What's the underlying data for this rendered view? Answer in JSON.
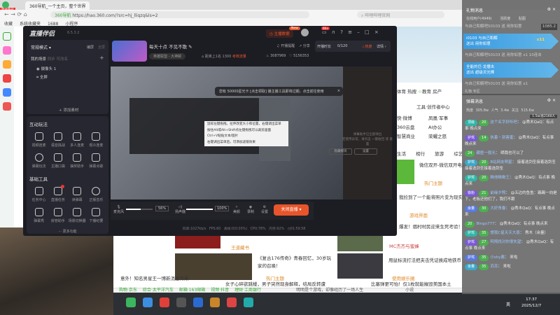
{
  "browser": {
    "tab_title": "360导航_一个主页，整个世界",
    "url": "https://hao.360.com/?src=hj_lliqzq&ls=2",
    "url_label": "360导航",
    "search_placeholder": "哔哩哔哩官网",
    "bookmarks": [
      "收藏",
      "系统收藏夹",
      "1688",
      "小程序"
    ],
    "login_badge": "登录账号"
  },
  "page": {
    "nav": [
      "体育",
      "热搜",
      "教育",
      "房产"
    ],
    "tools": "工具·创作者中心",
    "links": [
      "凤凰·军事",
      "AI办公",
      "荣耀之怒",
      "快·微博",
      "360云盘",
      "智慧商业"
    ],
    "tabs": [
      "生活",
      "榜行",
      "旅游",
      "综艺"
    ],
    "articles": [
      "微信双开-微信双开电脑版",
      "我捡到了一个能将照片变为现实的相机",
      "爆发！烟村村民迎来生死考验！",
      "《复古176传奇》青春回忆，30岁玩家的召唤！",
      "用鼠标流打法把夹击凭证换成地铁币",
      "女子心碎欲跳楼，男子突然现身解释，结局反转遭",
      "比塞弹更可怕！仅1枚就能摧毁美国本土",
      "意外！知名男星王一博新消息传来"
    ],
    "sources": [
      "热门主题",
      "游戏界面",
      "MC杰杰与蜜蜂",
      "王道藏书",
      "热门主题",
      "使用娱乐圈"
    ],
    "status": [
      "购物·京东",
      "综合·太平洋汽车",
      "邮箱·163邮箱",
      "视频·抖音",
      "理财·工商银行"
    ],
    "status_right": "明明是个游戏，却像经历了一场人生",
    "status_novel": "小说"
  },
  "app": {
    "name": "直播伴侣",
    "version": "6.5.3.2",
    "live_data": "主播数据",
    "new": "New",
    "msg_count": "99+",
    "mode": "常规模式",
    "edit": "编屏",
    "full": "全屏",
    "scene_title": "我的场景",
    "scene_actions": [
      "同步",
      "可改名"
    ],
    "sources": [
      "摄像头 1",
      "全屏"
    ],
    "add_source": "添加素材",
    "interact_title": "互动玩法",
    "interact": [
      "视频连麦",
      "语音挑战",
      "多人连麦",
      "观众连麦",
      "弹幕玩法",
      "主播口袋",
      "抽奖助手",
      "弹幕点歌"
    ],
    "tools_title": "基础工具",
    "tools": [
      "任务中心",
      "直播任务",
      "读弹幕",
      "正版音乐",
      "弹幕秀",
      "房管助手",
      "场景切换器",
      "下播纪要"
    ],
    "more": "更多功能",
    "stream_title": "每天十点 不见不散",
    "category": "英雄联盟 - 大神邮",
    "rank": "距离上1名 1300",
    "popularity": "考核流量",
    "hot": "3087969",
    "likes": "5156353",
    "remind": "开播提醒",
    "share": "分享",
    "duration_label": "开播时长",
    "duration": "0/120",
    "hotness": "热度",
    "details": "详情",
    "notice": "您有 50000星光卡 [点击领取] 播主播工具即将过期，点击前往使用",
    "tooltip": [
      "鼠标左键拖拽，拉伸改变大小和位置，右键调出菜单",
      "按住Alt或Alt+Shift点左键拖拽可以裁剪画面",
      "Ctrl+V粘贴文本/图片",
      "右键调出菜单后，可添加滤镜效果"
    ],
    "danmu_hint": [
      "弹幕助手已全部弹出",
      "若使用异常，请点击 一键收回 或 重置"
    ],
    "hide_module": "隐藏模块",
    "settings": "设置",
    "mic": "麦克风",
    "mic_vol": "56%",
    "speaker": "扬声器",
    "spk_vol": "100%",
    "beauty": "美颜",
    "record": "录制",
    "setting": "设置",
    "stop": "关闭直播",
    "mic_level": 0.56,
    "spk_level": 1.0,
    "stats": [
      "码率:1027kb/s",
      "FPS:60",
      "丢帧:0(0.00%)",
      "CPU:78%",
      "内存:92%",
      "01:59:58"
    ]
  },
  "gift": {
    "title": "礼物消息",
    "online": "在线用户(4949)",
    "tabs": [
      "活跃度",
      "贴图"
    ],
    "count": "1085.2",
    "items": [
      "与自己和解吧50103 送 用你如意",
      "与自己和解吧50103 送 用你如意 x1 10连击",
      "与自己和解吧50103 送 用你如意 x1"
    ],
    "banner1": {
      "user": "i0103 与自己和解",
      "text": "送出 用你如意",
      "mult": "x11"
    },
    "banner2": {
      "user": "全能的巨·龙撞击",
      "text": "送出 超级灵光棒",
      "mult": "x1",
      "combo": "x402"
    },
    "footer": [
      "礼物",
      "专区"
    ]
  },
  "chat": {
    "title": "弹幕消息",
    "stats": [
      "热度 305.8w",
      "人气 3.4w",
      "关注 515.6w"
    ],
    "viewers": "1.5w/总2160人",
    "messages": [
      {
        "badge": "顶级",
        "level": "20",
        "user": "这个名字好听吧",
        "text": "@秀木QaQ：有点事 晚点来"
      },
      {
        "badge": "护驾",
        "level": "14",
        "user": "执着丶别害羞",
        "text": "@秀木QaQ：有点事 晚点来"
      },
      {
        "badge": "",
        "level": "24",
        "user": "藏匿一般光",
        "text": "晒我也可以了"
      },
      {
        "badge": "护驾",
        "level": "20",
        "user": "B站网友明星",
        "text": "接着选剑圣接着选剑圣接着选剑圣接着选剑圣"
      },
      {
        "badge": "护驾",
        "level": "20",
        "user": "瞅他瞅瞅王",
        "text": "@秀木QaQ：有点事 晚点来"
      },
      {
        "badge": "铁粉",
        "level": "21",
        "user": "前缘夕照",
        "text": "@五边的鱼鱼：踢踢一向是下，老板还他们了，我们不跟"
      },
      {
        "badge": "余量",
        "level": "30",
        "user": "大好青春",
        "text": "@秀木QaQ：有点事 晚点来"
      },
      {
        "badge": "",
        "level": "20",
        "user": "Bingo777",
        "text": "@秀木QaQ：有点事 晚点来"
      },
      {
        "badge": "护驾",
        "level": "35",
        "user": "想我C星天天大喜",
        "text": "秀木（余量）"
      },
      {
        "badge": "护驾",
        "level": "27",
        "user": "阿翔找对你很失望",
        "text": "@秀木QaQ：有点事 晚点来"
      },
      {
        "badge": "护驾",
        "level": "35",
        "user": "小shy酱",
        "text": "来啦"
      },
      {
        "badge": "余量",
        "level": "35",
        "user": "苏苏",
        "text": "来啦"
      }
    ]
  },
  "taskbar": {
    "time": "17:37",
    "date": "2025/12/7",
    "ime": "英"
  }
}
